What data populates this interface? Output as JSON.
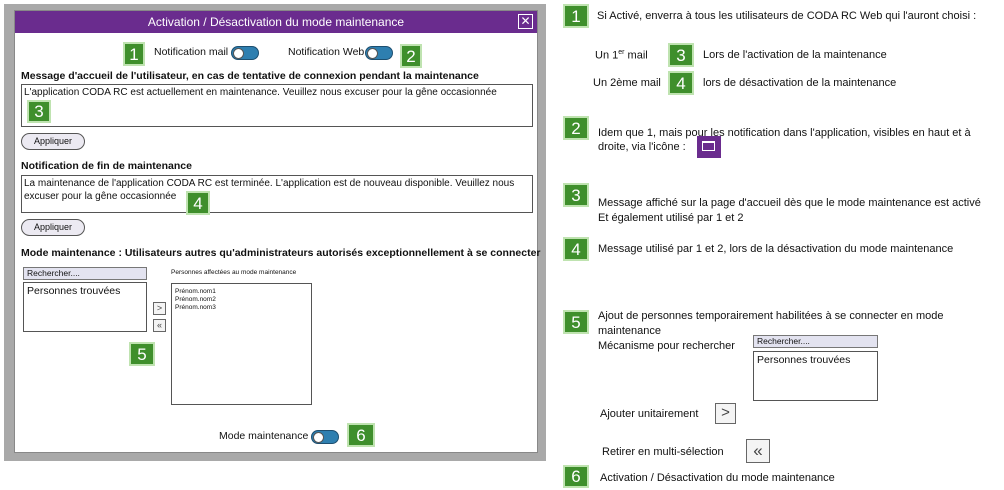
{
  "dialog": {
    "title": "Activation / Désactivation du mode maintenance",
    "close_symbol": "✕",
    "notif_mail_label": "Notification mail",
    "notif_web_label": "Notification Web",
    "welcome_heading": "Message  d'accueil de l'utilisateur, en cas de tentative de  connexion pendant la maintenance",
    "welcome_message": "L'application CODA RC est actuellement en maintenance. Veuillez nous excuser pour la gêne occasionnée",
    "apply_label": "Appliquer",
    "end_heading": "Notification de fin de maintenance",
    "end_message": "La maintenance de l'application CODA RC est terminée. L'application est de nouveau disponible. Veuillez nous excuser pour la gêne occasionnée",
    "users_heading": "Mode maintenance : Utilisateurs autres qu'administrateurs autorisés exceptionnellement à se connecter",
    "search_placeholder": "Rechercher....",
    "found_label": "Personnes trouvées",
    "add_symbol": ">",
    "remove_symbol": "«",
    "affected_label": "Personnes affectées au mode maintenance",
    "affected_people": [
      "Prénom.nom1",
      "Prénom.nom2",
      "Prénom.nom3"
    ],
    "mode_label": "Mode maintenance"
  },
  "badges": [
    "1",
    "2",
    "3",
    "4",
    "5",
    "6"
  ],
  "notes": {
    "n1": "Si Activé, enverra à tous les utilisateurs de CODA RC Web qui l'auront choisi :",
    "n1a_prefix": "Un 1",
    "n1a_sup": "er",
    "n1a_suffix": " mail",
    "n1a_desc": "Lors de l'activation de la maintenance",
    "n1b": "Un 2ème mail",
    "n1b_desc": "lors de désactivation de la maintenance",
    "n2_line1": "Idem que 1, mais pour les notification dans l'application, visibles en haut et à",
    "n2_line2": "droite, via l'icône :",
    "n3_line1": "Message affiché sur la page d'accueil dès que le mode maintenance est activé",
    "n3_line2": "Et également utilisé par 1 et 2",
    "n4": "Message utilisé par 1 et 2, lors de la désactivation du mode maintenance",
    "n5_line1": "Ajout de personnes temporairement habilitées à se connecter en mode",
    "n5_line2": "maintenance",
    "n5_line3": "Mécanisme pour rechercher",
    "n5_search": "Rechercher....",
    "n5_found": "Personnes trouvées",
    "n5_add": "Ajouter unitairement",
    "n5_add_symbol": ">",
    "n5_remove": "Retirer en multi-sélection",
    "n5_remove_symbol": "«",
    "n6": "Activation / Désactivation du mode maintenance"
  }
}
